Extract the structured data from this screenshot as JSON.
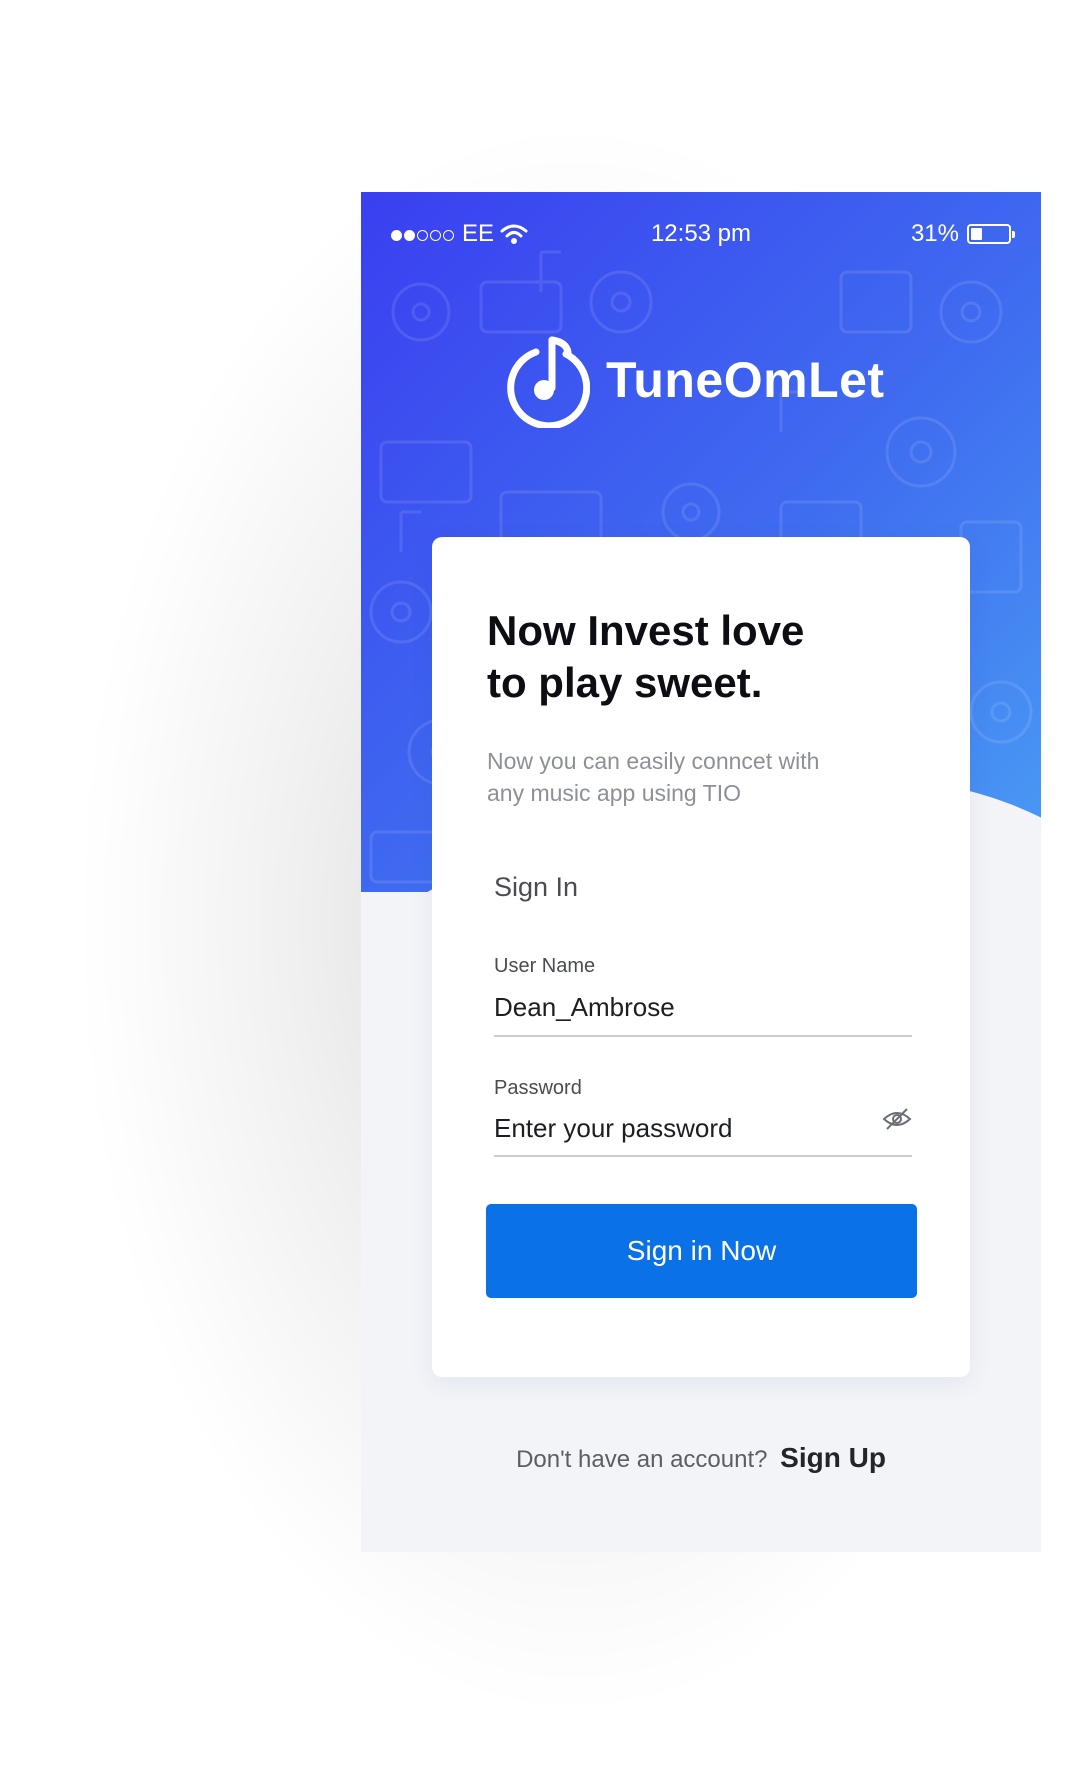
{
  "status_bar": {
    "carrier": "EE",
    "time": "12:53 pm",
    "battery": "31%",
    "battery_level": 0.31,
    "signal_bars_filled": 2,
    "signal_bars_total": 5
  },
  "brand": {
    "name": "TuneOmLet",
    "icon": "music-note-circle-icon"
  },
  "card": {
    "headline_line1": "Now Invest  love",
    "headline_line2": "to play sweet.",
    "subtext_line1": "Now you can easily conncet with",
    "subtext_line2": "any music app using TIO",
    "section_title": "Sign In",
    "username": {
      "label": "User Name",
      "value": "Dean_Ambrose"
    },
    "password": {
      "label": "Password",
      "placeholder": "Enter your password",
      "toggle_icon": "eye-hidden-icon"
    },
    "submit_label": "Sign in Now"
  },
  "footer": {
    "prompt": "Don't have an account?",
    "link_label": "Sign Up"
  },
  "colors": {
    "hero_start": "#3a3ff0",
    "hero_end": "#4a9df4",
    "button": "#0a72e6",
    "background": "#f3f4f8"
  }
}
